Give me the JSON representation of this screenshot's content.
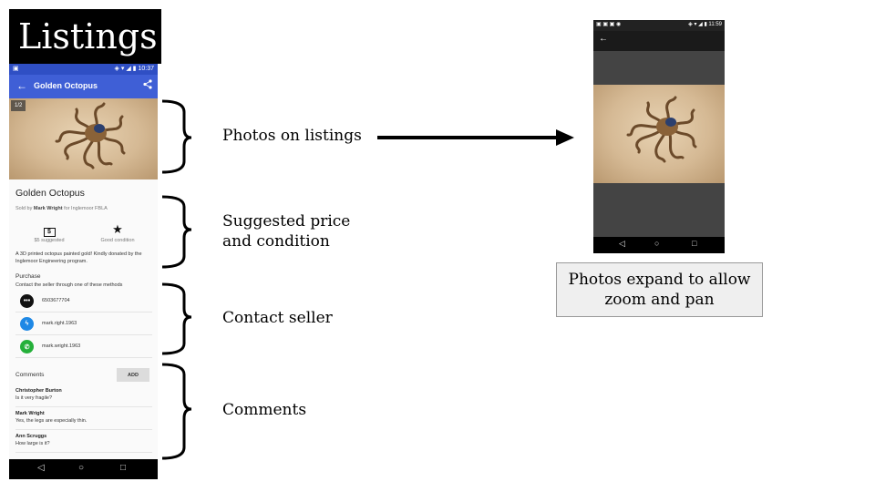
{
  "slide": {
    "title": "Listings",
    "annotations": [
      "Photos on listings",
      "Suggested price\nand condition",
      "Contact seller",
      "Comments"
    ],
    "caption": "Photos expand to allow zoom and pan"
  },
  "listing_phone": {
    "status_time": "10:37",
    "app_title": "Golden Octopus",
    "photo_counter": "1/2",
    "product_name": "Golden Octopus",
    "sold_prefix": "Sold by",
    "seller": "Mark Wright",
    "sold_suffix": "for Inglemoor FBLA",
    "price_label": "$5 suggested",
    "condition_label": "Good condition",
    "description": "A 3D printed octopus painted gold! Kindly donated by the Inglemoor Engineering program.",
    "purchase_heading": "Purchase",
    "contact_text": "Contact the seller through one of these methods",
    "contacts": [
      {
        "icon": "sms-icon",
        "value": "6503677704",
        "color": "#111111"
      },
      {
        "icon": "messenger-icon",
        "value": "mark.right.1963",
        "color": "#1e88e5"
      },
      {
        "icon": "whatsapp-icon",
        "value": "mark.wright.1963",
        "color": "#25b03a"
      }
    ],
    "comments_heading": "Comments",
    "add_label": "ADD",
    "comments": [
      {
        "author": "Christopher Burton",
        "text": "Is it very fragile?"
      },
      {
        "author": "Mark Wright",
        "text": "Yes, the legs are especially thin."
      },
      {
        "author": "Ann Scruggs",
        "text": "How large is it?"
      }
    ]
  },
  "viewer_phone": {
    "status_time": "11:59"
  },
  "colors": {
    "app_bar": "#3f5fd6",
    "status_bar": "#2f4fc4",
    "banner": "#000000",
    "caption_bg": "#efefef"
  }
}
